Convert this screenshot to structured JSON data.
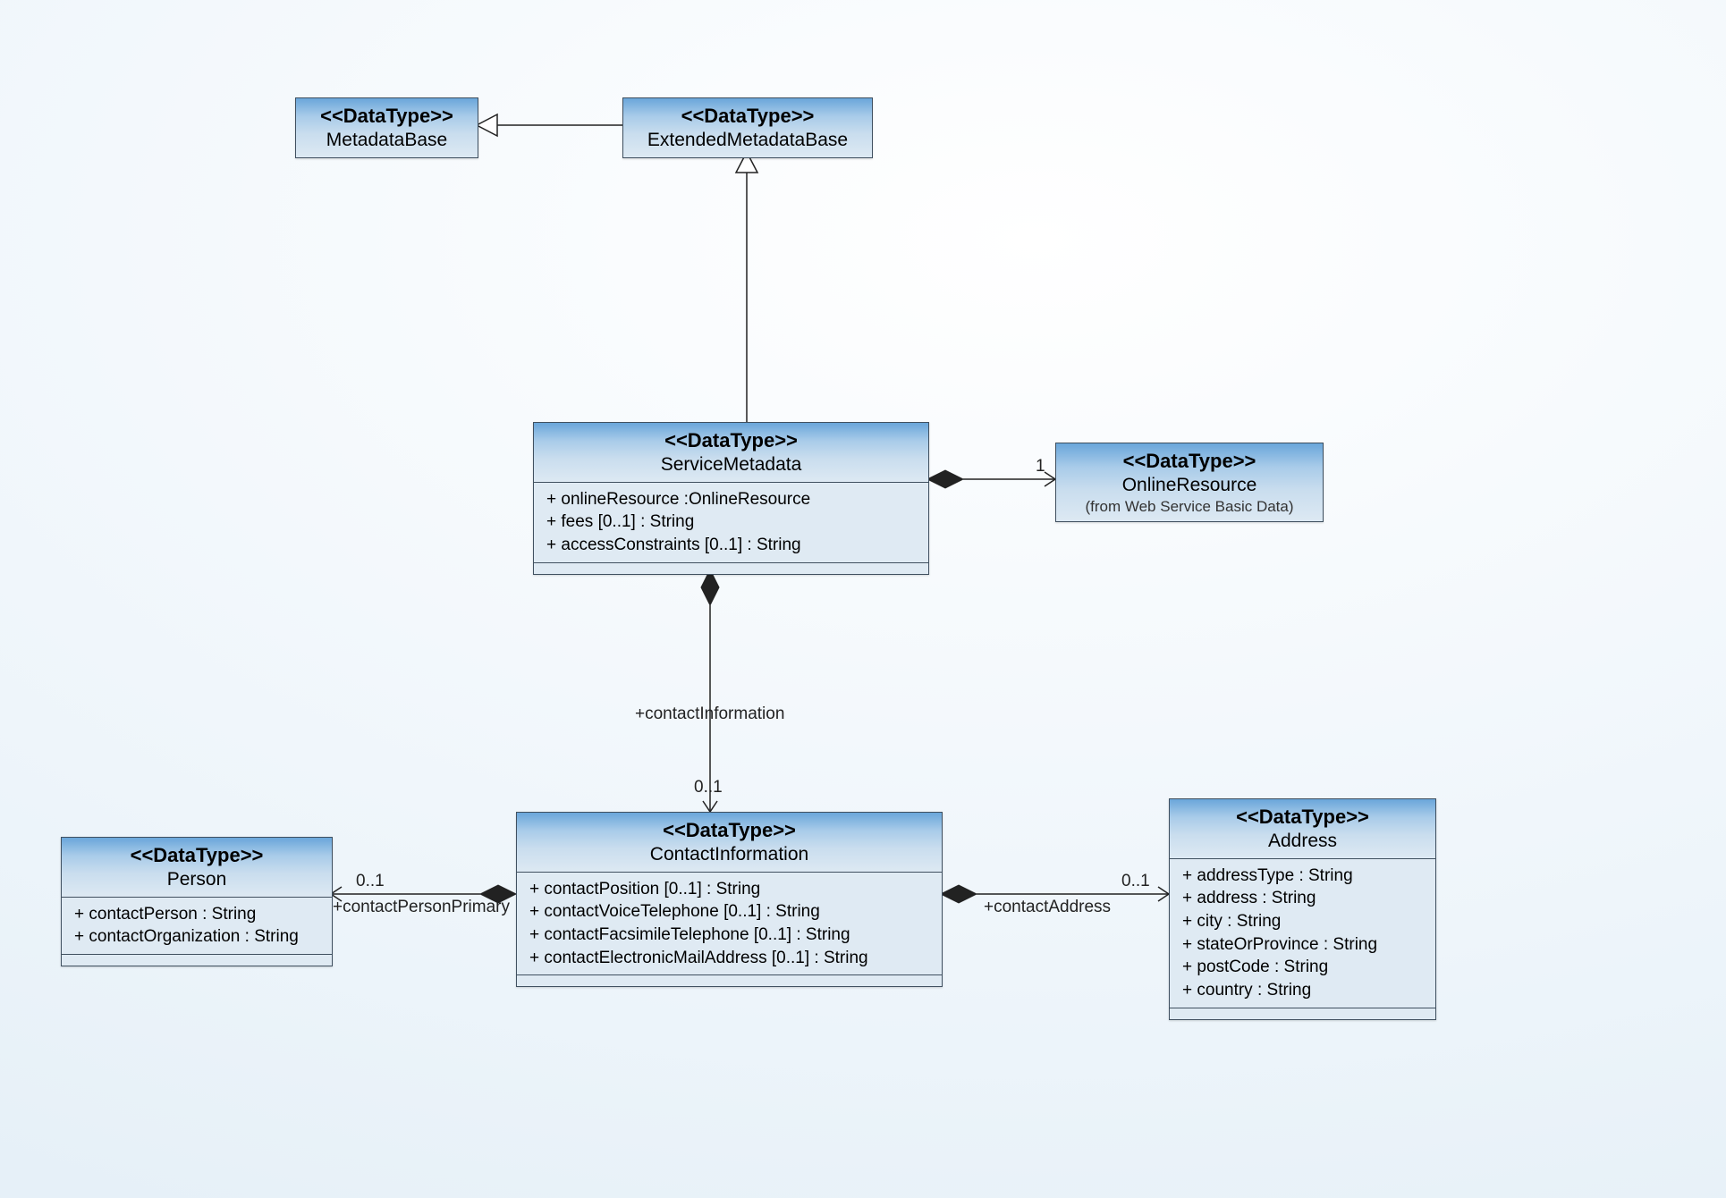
{
  "stereotype": "<<DataType>>",
  "classes": {
    "metadataBase": {
      "name": "MetadataBase"
    },
    "extendedMetadataBase": {
      "name": "ExtendedMetadataBase"
    },
    "serviceMetadata": {
      "name": "ServiceMetadata",
      "attr1": "+ onlineResource :OnlineResource",
      "attr2": "+ fees [0..1] : String",
      "attr3": "+ accessConstraints [0..1] : String"
    },
    "onlineResource": {
      "name": "OnlineResource",
      "subtitle": "(from Web Service Basic Data)"
    },
    "contactInformation": {
      "name": "ContactInformation",
      "attr1": "+ contactPosition [0..1] : String",
      "attr2": "+ contactVoiceTelephone [0..1] : String",
      "attr3": "+ contactFacsimileTelephone [0..1] : String",
      "attr4": "+ contactElectronicMailAddress [0..1] : String"
    },
    "person": {
      "name": "Person",
      "attr1": "+ contactPerson : String",
      "attr2": "+ contactOrganization : String"
    },
    "address": {
      "name": "Address",
      "attr1": "+ addressType : String",
      "attr2": "+ address : String",
      "attr3": "+ city : String",
      "attr4": "+ stateOrProvince : String",
      "attr5": "+ postCode : String",
      "attr6": "+ country : String"
    }
  },
  "edges": {
    "contactInformationRole": "+contactInformation",
    "contactInformationMult": "0..1",
    "onlineResourceMult": "1",
    "personMult": "0..1",
    "personRole": "+contactPersonPrimary",
    "addressMult": "0..1",
    "addressRole": "+contactAddress"
  }
}
